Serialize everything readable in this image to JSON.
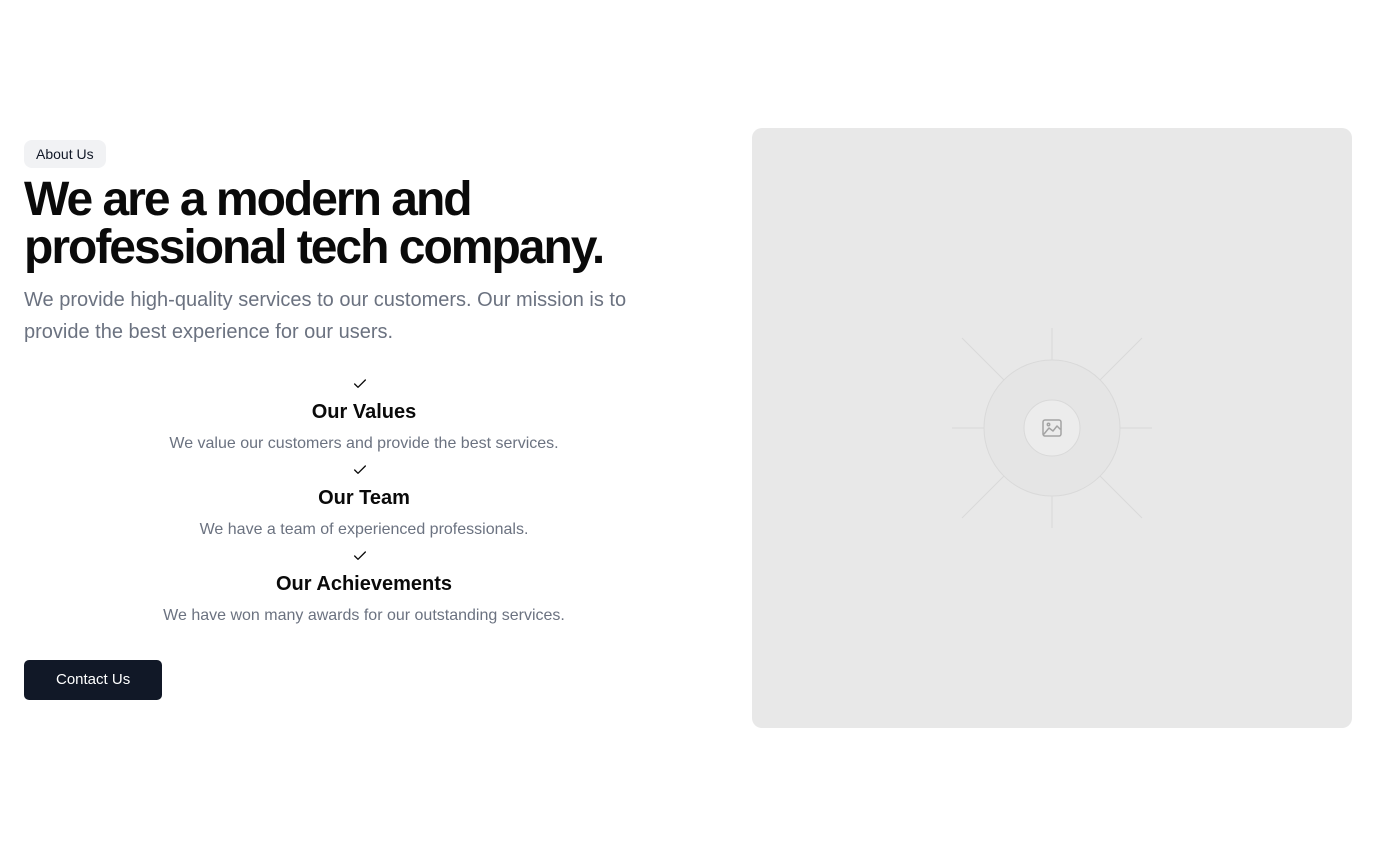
{
  "hero": {
    "badge": "About Us",
    "headline_line1": "We are a modern and",
    "headline_line2": "professional tech company.",
    "lede": "We provide high-quality services to our customers. Our mission is to provide the best experience for our users."
  },
  "features": [
    {
      "icon": "check-icon",
      "title": "Our Values",
      "description": "We value our customers and provide the best services."
    },
    {
      "icon": "check-icon",
      "title": "Our Team",
      "description": "We have a team of experienced professionals."
    },
    {
      "icon": "check-icon",
      "title": "Our Achievements",
      "description": "We have won many awards for our outstanding services."
    }
  ],
  "cta": {
    "label": "Contact Us"
  },
  "media": {
    "icon": "image-placeholder-icon",
    "background_color": "#e8e8e8"
  },
  "colors": {
    "heading": "#0a0a0a",
    "muted_text": "#6b7280",
    "button_bg": "#111827",
    "badge_bg": "#f1f2f4"
  }
}
